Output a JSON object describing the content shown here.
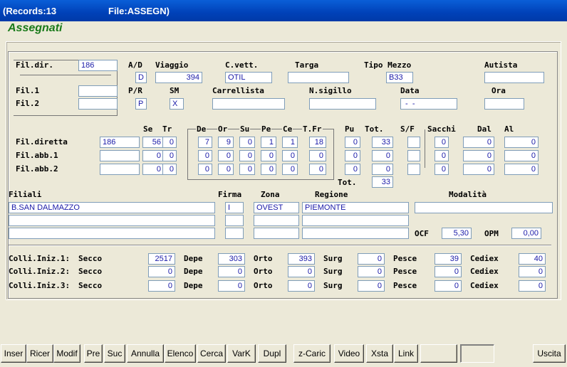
{
  "title": {
    "records": "(Records:13",
    "file": "File:ASSEGN)"
  },
  "heading": "Assegnati",
  "labels": {
    "fil_dir": "Fil.dir.",
    "ad": "A/D",
    "viaggio": "Viaggio",
    "cvett": "C.vett.",
    "targa": "Targa",
    "tipo_mezzo": "Tipo Mezzo",
    "autista": "Autista",
    "fil1": "Fil.1",
    "fil2": "Fil.2",
    "pr": "P/R",
    "sm": "SM",
    "carrellista": "Carrellista",
    "nsigillo": "N.sigillo",
    "data": "Data",
    "ora": "Ora",
    "se": "Se",
    "tr": "Tr",
    "de": "De",
    "or": "Or",
    "su": "Su",
    "pe": "Pe",
    "ce": "Ce",
    "tfr": "T.Fr",
    "pu": "Pu",
    "tot": "Tot.",
    "sf": "S/F",
    "sacchi": "Sacchi",
    "dal": "Dal",
    "al": "Al",
    "fil_diretta": "Fil.diretta",
    "fil_abb1": "Fil.abb.1",
    "fil_abb2": "Fil.abb.2",
    "tot2": "Tot.",
    "filiali": "Filiali",
    "firma": "Firma",
    "zona": "Zona",
    "regione": "Regione",
    "modalita": "Modalità",
    "ocf": "OCF",
    "opm": "OPM",
    "colli1": "Colli.Iniz.1:",
    "colli2": "Colli.Iniz.2:",
    "colli3": "Colli.Iniz.3:",
    "secco": "Secco",
    "depe": "Depe",
    "orto": "Orto",
    "surg": "Surg",
    "pesce": "Pesce",
    "cediex": "Cediex"
  },
  "header": {
    "fil_dir": "186",
    "ad": "D",
    "viaggio": "394",
    "cvett": "OTIL",
    "targa": "",
    "tipo_mezzo": "B33",
    "autista": "",
    "fil1": "",
    "fil2": "",
    "pr": "P",
    "sm": "X",
    "carrellista": "",
    "nsigillo": "",
    "data": " -  - ",
    "ora": ""
  },
  "rows": [
    {
      "fil": "186",
      "se": "56",
      "tr": "0",
      "de": "7",
      "or": "9",
      "su": "0",
      "pe": "1",
      "ce": "1",
      "tfr": "18",
      "pu": "0",
      "tot": "33",
      "sf": "",
      "sacchi": "0",
      "dal": "0",
      "al": "0"
    },
    {
      "fil": "",
      "se": "0",
      "tr": "0",
      "de": "0",
      "or": "0",
      "su": "0",
      "pe": "0",
      "ce": "0",
      "tfr": "0",
      "pu": "0",
      "tot": "0",
      "sf": "",
      "sacchi": "0",
      "dal": "0",
      "al": "0"
    },
    {
      "fil": "",
      "se": "0",
      "tr": "0",
      "de": "0",
      "or": "0",
      "su": "0",
      "pe": "0",
      "ce": "0",
      "tfr": "0",
      "pu": "0",
      "tot": "0",
      "sf": "",
      "sacchi": "0",
      "dal": "0",
      "al": "0"
    }
  ],
  "grand_tot": "33",
  "filiali": [
    {
      "nome": "B.SAN DALMAZZO",
      "firma": "I",
      "zona": "OVEST",
      "regione": "PIEMONTE"
    },
    {
      "nome": "",
      "firma": "",
      "zona": "",
      "regione": ""
    },
    {
      "nome": "",
      "firma": "",
      "zona": "",
      "regione": ""
    }
  ],
  "modalita": "",
  "ocf": "5,30",
  "opm": "0,00",
  "colli": [
    {
      "secco": "2517",
      "depe": "303",
      "orto": "393",
      "surg": "0",
      "pesce": "39",
      "cediex": "40"
    },
    {
      "secco": "0",
      "depe": "0",
      "orto": "0",
      "surg": "0",
      "pesce": "0",
      "cediex": "0"
    },
    {
      "secco": "0",
      "depe": "0",
      "orto": "0",
      "surg": "0",
      "pesce": "0",
      "cediex": "0"
    }
  ],
  "buttons": [
    "Inser",
    "Ricer",
    "Modif",
    "Pre",
    "Suc",
    "Annulla",
    "Elenco",
    "Cerca",
    "VarK",
    "Dupl",
    "z-Caric",
    "Video",
    "Xsta",
    "Link",
    "",
    "",
    "Uscita"
  ]
}
